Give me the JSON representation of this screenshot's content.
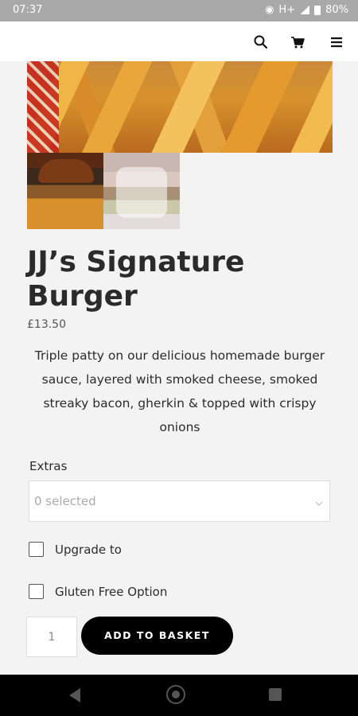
{
  "status_bar": {
    "time": "07:37",
    "network": "H+",
    "battery": "80%"
  },
  "header": {
    "icons": [
      "search-icon",
      "cart-icon",
      "menu-icon"
    ]
  },
  "product": {
    "title": "JJ’s Signature Burger",
    "price": "£13.50",
    "description": "Triple patty on our delicious homemade burger sauce, layered with smoked cheese, smoked streaky bacon, gherkin & topped with crispy onions"
  },
  "options": {
    "extras_label": "Extras",
    "extras_value": "0 selected",
    "checkboxes": [
      {
        "label": "Upgrade to",
        "checked": false
      },
      {
        "label": "Gluten Free Option",
        "checked": false
      }
    ]
  },
  "purchase": {
    "quantity": "1",
    "add_button": "ADD TO BASKET"
  },
  "colors": {
    "button_bg": "#000000",
    "page_bg": "#f3f3f3"
  }
}
